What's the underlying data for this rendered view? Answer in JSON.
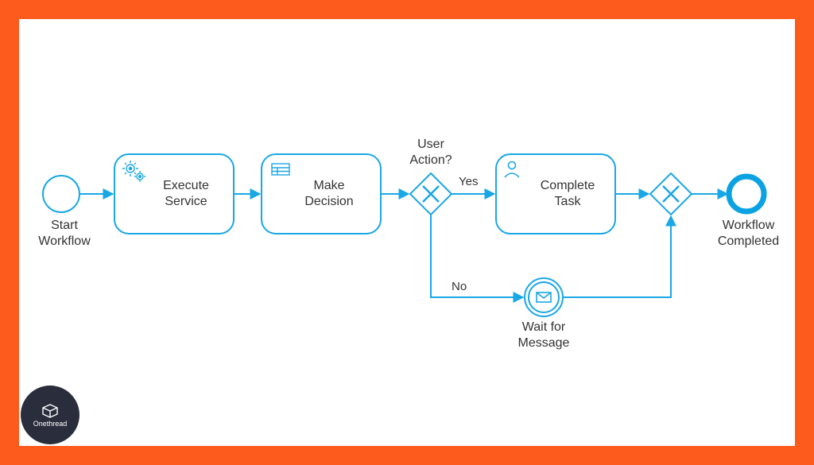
{
  "colors": {
    "stroke": "#1aa7e5",
    "strokeBold": "#0aa2e3",
    "text": "#333333",
    "border": "#fd5a1e"
  },
  "logo": {
    "name": "Onethread"
  },
  "nodes": {
    "start": {
      "type": "start-event",
      "label": "Start\nWorkflow"
    },
    "execService": {
      "type": "service-task",
      "label": "Execute\nService"
    },
    "makeDecision": {
      "type": "business-task",
      "label": "Make\nDecision"
    },
    "gateway1": {
      "type": "xor-gateway",
      "label": "User\nAction?"
    },
    "completeTask": {
      "type": "user-task",
      "label": "Complete\nTask"
    },
    "gateway2": {
      "type": "xor-gateway",
      "label": ""
    },
    "end": {
      "type": "end-event",
      "label": "Workflow\nCompleted"
    },
    "waitMsg": {
      "type": "message-event",
      "label": "Wait for\nMessage"
    }
  },
  "edges": {
    "start_exec": {
      "from": "start",
      "to": "execService"
    },
    "exec_decide": {
      "from": "execService",
      "to": "makeDecision"
    },
    "decide_gw1": {
      "from": "makeDecision",
      "to": "gateway1"
    },
    "gw1_yes": {
      "from": "gateway1",
      "to": "completeTask",
      "label": "Yes"
    },
    "task_gw2": {
      "from": "completeTask",
      "to": "gateway2"
    },
    "gw2_end": {
      "from": "gateway2",
      "to": "end"
    },
    "gw1_no": {
      "from": "gateway1",
      "to": "waitMsg",
      "label": "No"
    },
    "wait_gw2": {
      "from": "waitMsg",
      "to": "gateway2"
    }
  }
}
